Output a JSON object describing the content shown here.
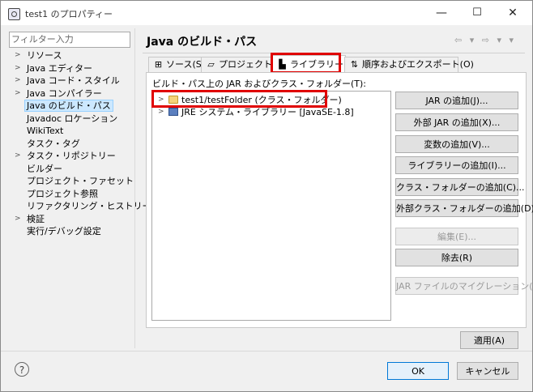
{
  "window": {
    "title": "test1 のプロパティー",
    "minimize_label": "—",
    "maximize_label": "☐",
    "close_label": "✕"
  },
  "filter": {
    "placeholder": "フィルター入力"
  },
  "tree": {
    "items": [
      {
        "label": "リソース",
        "expandable": true
      },
      {
        "label": "Java エディター",
        "expandable": true
      },
      {
        "label": "Java コード・スタイル",
        "expandable": true
      },
      {
        "label": "Java コンパイラー",
        "expandable": true
      },
      {
        "label": "Java のビルド・パス",
        "expandable": false,
        "selected": true
      },
      {
        "label": "Javadoc ロケーション",
        "expandable": false
      },
      {
        "label": "WikiText",
        "expandable": false
      },
      {
        "label": "タスク・タグ",
        "expandable": false
      },
      {
        "label": "タスク・リポジトリー",
        "expandable": true
      },
      {
        "label": "ビルダー",
        "expandable": false
      },
      {
        "label": "プロジェクト・ファセット",
        "expandable": false
      },
      {
        "label": "プロジェクト参照",
        "expandable": false
      },
      {
        "label": "リファクタリング・ヒストリー",
        "expandable": false
      },
      {
        "label": "検証",
        "expandable": true
      },
      {
        "label": "実行/デバッグ設定",
        "expandable": false
      }
    ]
  },
  "page": {
    "title": "Java のビルド・パス",
    "nav_icons": "⇦ ▾ ⇨ ▾ ▾"
  },
  "tabs": {
    "source": "ソース(S)",
    "project": "プロジェクト(P)",
    "libraries": "ライブラリー(L)",
    "order": "順序およびエクスポート(O)"
  },
  "panel": {
    "path_label": "ビルド・パス上の JAR およびクラス・フォルダー(T):",
    "libs": [
      {
        "label": "test1/testFolder (クラス・フォルダー)",
        "icon": "folder-icon"
      },
      {
        "label": "JRE システム・ライブラリー [JavaSE-1.8]",
        "icon": "library-icon"
      }
    ]
  },
  "buttons": {
    "add_jar": "JAR の追加(J)...",
    "add_external_jar": "外部 JAR の追加(X)...",
    "add_variable": "変数の追加(V)...",
    "add_library": "ライブラリーの追加(I)...",
    "add_class_folder": "クラス・フォルダーの追加(C)...",
    "add_external_class_folder": "外部クラス・フォルダーの追加(D)...",
    "edit": "編集(E)...",
    "remove": "除去(R)",
    "migrate_jar": "JAR ファイルのマイグレーション(M)...",
    "apply": "適用(A)",
    "ok": "OK",
    "cancel": "キャンセル",
    "help": "?"
  },
  "colors": {
    "highlight": "#e00000",
    "selection": "#cce8ff",
    "default_button_border": "#0078d7"
  }
}
